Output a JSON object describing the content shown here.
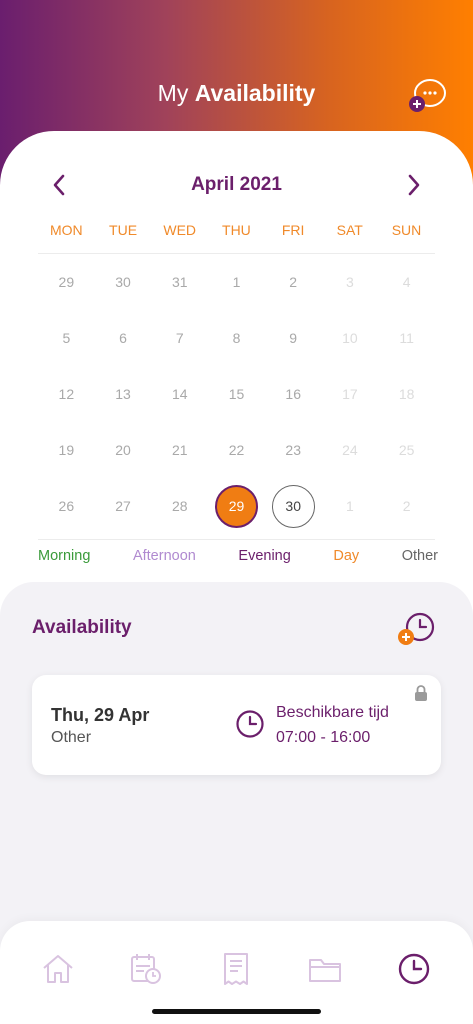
{
  "header": {
    "title_light": "My",
    "title_bold": "Availability",
    "chat_icon": "chat-bubble-add-icon"
  },
  "calendar": {
    "month_label": "April 2021",
    "weekdays": [
      "MON",
      "TUE",
      "WED",
      "THU",
      "FRI",
      "SAT",
      "SUN"
    ],
    "weeks": [
      [
        "29",
        "30",
        "31",
        "1",
        "2",
        "3",
        "4"
      ],
      [
        "5",
        "6",
        "7",
        "8",
        "9",
        "10",
        "11"
      ],
      [
        "12",
        "13",
        "14",
        "15",
        "16",
        "17",
        "18"
      ],
      [
        "19",
        "20",
        "21",
        "22",
        "23",
        "24",
        "25"
      ],
      [
        "26",
        "27",
        "28",
        "29",
        "30",
        "1",
        "2"
      ]
    ],
    "selected_day": "29",
    "today_day": "30"
  },
  "legend": [
    {
      "label": "Morning",
      "color": "#3a9a3a"
    },
    {
      "label": "Afternoon",
      "color": "#b08ad0"
    },
    {
      "label": "Evening",
      "color": "#6b1f6b"
    },
    {
      "label": "Day",
      "color": "#f08a2a"
    },
    {
      "label": "Other",
      "color": "#666666"
    }
  ],
  "availability": {
    "title": "Availability",
    "entry": {
      "date": "Thu, 29 Apr",
      "type": "Other",
      "time_label": "Beschikbare tijd",
      "time_range": "07:00 - 16:00"
    }
  },
  "colors": {
    "accent_purple": "#6b1f6b",
    "accent_orange": "#f07d13"
  },
  "tabs": [
    {
      "icon": "home-icon"
    },
    {
      "icon": "calendar-clock-icon"
    },
    {
      "icon": "receipt-icon"
    },
    {
      "icon": "folder-icon"
    },
    {
      "icon": "clock-icon"
    }
  ]
}
